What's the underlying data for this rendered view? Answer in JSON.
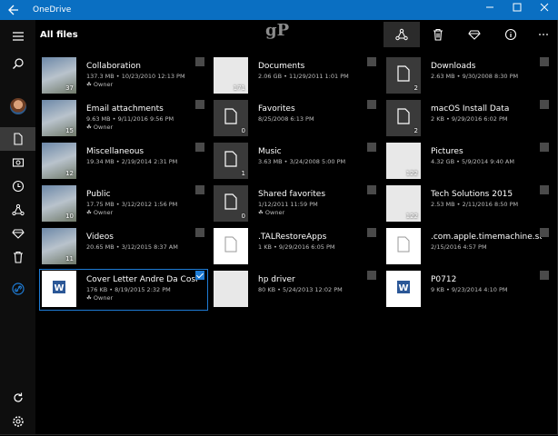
{
  "window": {
    "app_title": "OneDrive",
    "back_icon": "back-arrow-icon",
    "minimize_icon": "minimize-icon",
    "maximize_icon": "maximize-icon",
    "close_icon": "close-icon",
    "accent": "#0a6fc2"
  },
  "header": {
    "title": "All files"
  },
  "watermark": "gP",
  "toolbar": [
    "share-icon",
    "trash-icon",
    "offline-download-icon",
    "info-icon",
    "more-icon"
  ],
  "sidebar": [
    "hamburger-icon",
    "search-icon",
    "avatar",
    "files-icon",
    "photos-icon",
    "recent-icon",
    "shared-icon",
    "offline-icon",
    "recycle-bin-icon",
    "onedrive-link-icon",
    "sync-icon",
    "settings-icon"
  ],
  "files": [
    {
      "name": "Collaboration",
      "meta": "137.3 MB • 10/23/2010 12:13 PM",
      "owner": "Owner",
      "thumb": "photo",
      "count": "37"
    },
    {
      "name": "Documents",
      "meta": "2.06 GB • 11/29/2011 1:01 PM",
      "owner": "",
      "thumb": "screen",
      "count": "171"
    },
    {
      "name": "Downloads",
      "meta": "2.63 MB • 9/30/2008 8:30 PM",
      "owner": "",
      "thumb": "folder",
      "count": "2"
    },
    {
      "name": "Email attachments",
      "meta": "9.63 MB • 9/11/2016 9:56 PM",
      "owner": "Owner",
      "thumb": "photo",
      "count": "15"
    },
    {
      "name": "Favorites",
      "meta": "8/25/2008 6:13 PM",
      "owner": "",
      "thumb": "folder",
      "count": "0"
    },
    {
      "name": "macOS Install Data",
      "meta": "2 KB • 9/29/2016 6:02 PM",
      "owner": "",
      "thumb": "folder",
      "count": "2"
    },
    {
      "name": "Miscellaneous",
      "meta": "19.34 MB • 2/19/2014 2:31 PM",
      "owner": "",
      "thumb": "photo",
      "count": "12"
    },
    {
      "name": "Music",
      "meta": "3.63 MB • 3/24/2008 5:00 PM",
      "owner": "",
      "thumb": "folder",
      "count": "1"
    },
    {
      "name": "Pictures",
      "meta": "4.32 GB • 5/9/2014 9:40 AM",
      "owner": "",
      "thumb": "screen",
      "count": "122"
    },
    {
      "name": "Public",
      "meta": "17.75 MB • 3/12/2012 1:56 PM",
      "owner": "Owner",
      "thumb": "photo",
      "count": "10"
    },
    {
      "name": "Shared favorites",
      "meta": "1/12/2011 11:59 PM",
      "owner": "Owner",
      "thumb": "folder",
      "count": "0"
    },
    {
      "name": "Tech Solutions 2015",
      "meta": "2.53 MB • 2/11/2016 8:50 PM",
      "owner": "",
      "thumb": "screen",
      "count": "122"
    },
    {
      "name": "Videos",
      "meta": "20.65 MB • 3/12/2015 8:37 AM",
      "owner": "",
      "thumb": "photo",
      "count": "11"
    },
    {
      "name": ".TALRestoreApps",
      "meta": "1 KB • 9/29/2016 6:05 PM",
      "owner": "",
      "thumb": "file",
      "count": ""
    },
    {
      "name": ".com.apple.timemachine.supported",
      "meta": "2/15/2016 4:57 PM",
      "owner": "",
      "thumb": "file",
      "count": ""
    },
    {
      "name": "Cover Letter Andre Da Costa - Di",
      "meta": "176 KB • 8/19/2015 2:32 PM",
      "owner": "Owner",
      "thumb": "word",
      "count": "",
      "selected": true
    },
    {
      "name": "hp driver",
      "meta": "80 KB • 5/24/2013 12:02 PM",
      "owner": "",
      "thumb": "screen",
      "count": ""
    },
    {
      "name": "P0712",
      "meta": "9 KB • 9/23/2014 4:10 PM",
      "owner": "",
      "thumb": "word",
      "count": ""
    }
  ]
}
